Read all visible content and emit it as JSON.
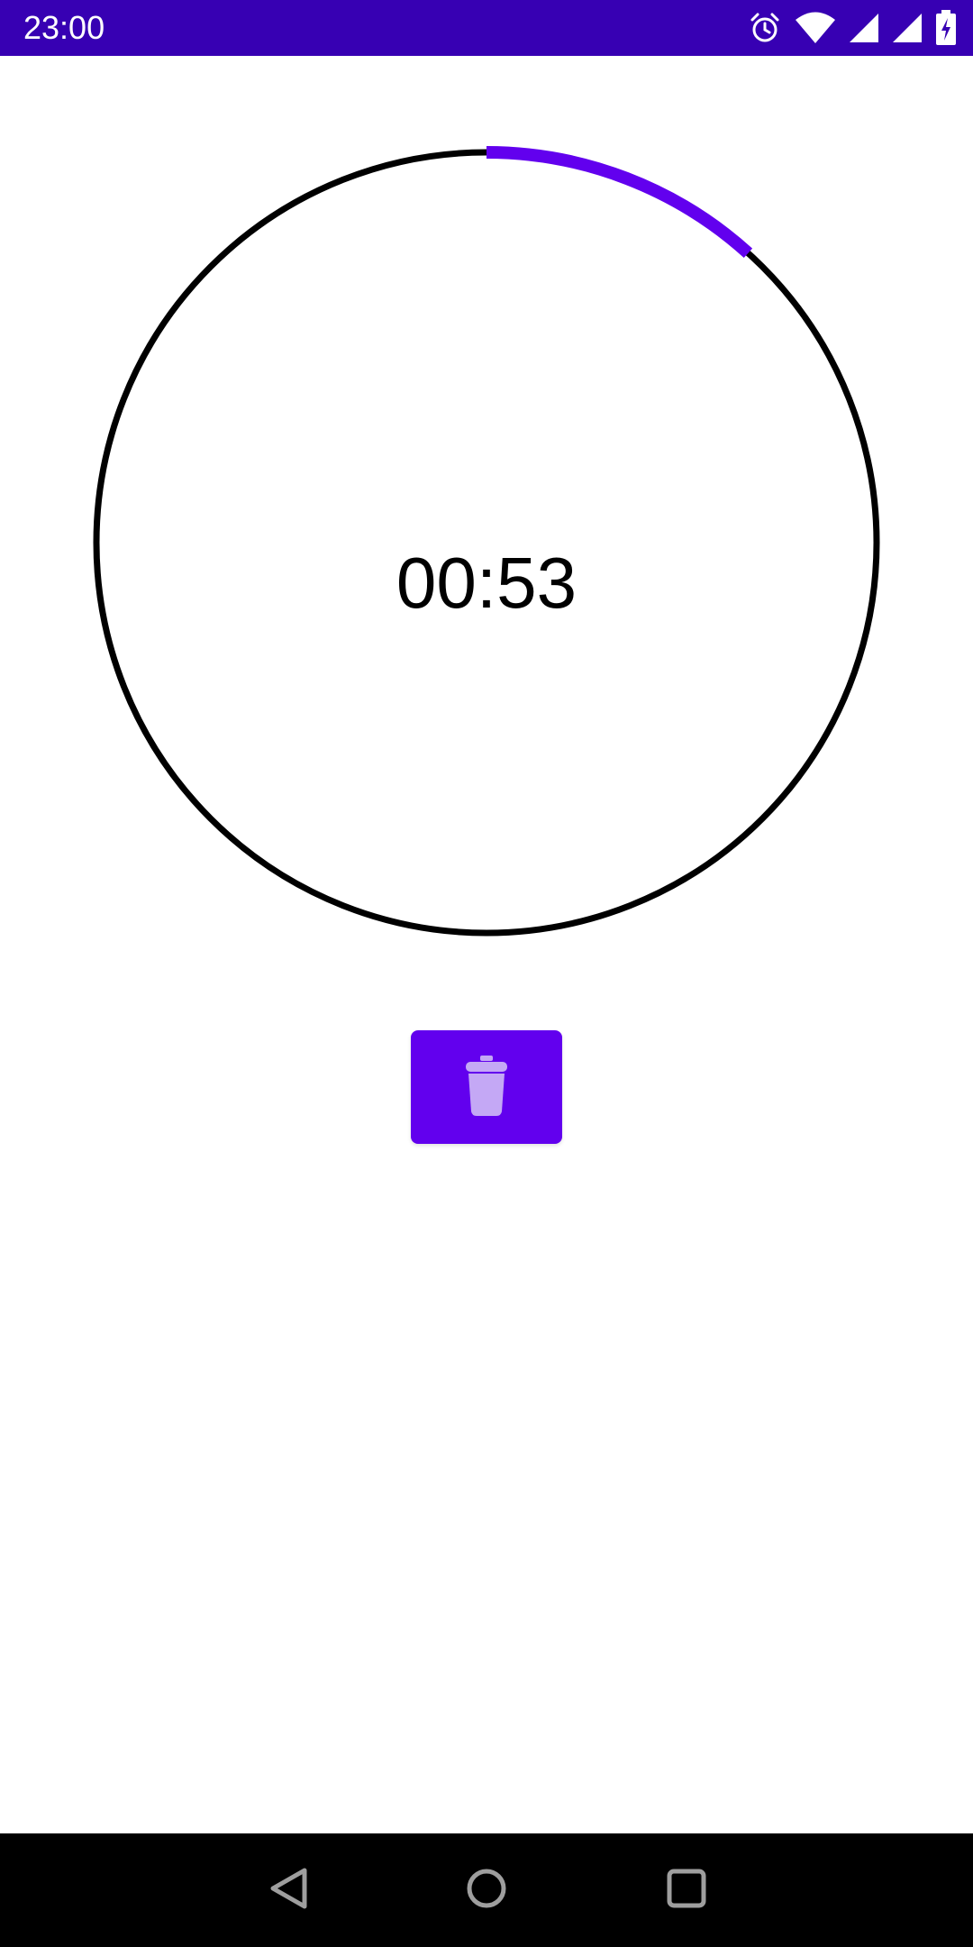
{
  "status_bar": {
    "time": "23:00",
    "background": "#3700B3",
    "icons": [
      "alarm-icon",
      "wifi-icon",
      "cellular-signal-icon",
      "cellular-signal-icon",
      "battery-charging-icon"
    ]
  },
  "timer": {
    "display": "00:53",
    "progress_fraction": 0.117,
    "ring_color": "#000000",
    "progress_color": "#6200EE"
  },
  "actions": {
    "delete_icon": "trash-icon",
    "button_color": "#6200EE",
    "icon_color": "#C4A8F5"
  },
  "navigation": {
    "icons": [
      "back-icon",
      "home-icon",
      "recents-icon"
    ]
  }
}
